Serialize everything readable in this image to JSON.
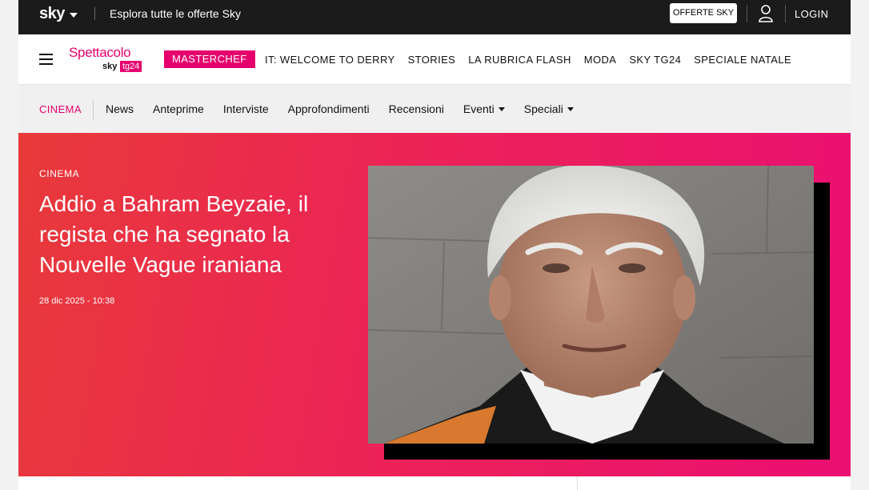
{
  "topbar": {
    "logo": "sky",
    "offers_link": "Esplora tutte le offerte Sky",
    "offers_button": "OFFERTE SKY",
    "login": "LOGIN",
    "icons": {
      "user": "user-icon",
      "chevron": "chevron-down-icon"
    }
  },
  "brand": {
    "name": "Spettacolo",
    "sub": "sky",
    "tag": "tg24"
  },
  "nav": {
    "highlight": "MASTERCHEF",
    "items": [
      "IT: WELCOME TO DERRY",
      "STORIES",
      "LA RUBRICA FLASH",
      "MODA",
      "SKY TG24",
      "SPECIALE NATALE"
    ]
  },
  "subnav": {
    "section": "CINEMA",
    "items": [
      "News",
      "Anteprime",
      "Interviste",
      "Approfondimenti",
      "Recensioni",
      "Eventi",
      "Speciali"
    ]
  },
  "hero": {
    "kicker": "CINEMA",
    "title": "Addio a Bahram Beyzaie, il regista che ha segnato la Nouvelle Vague iraniana",
    "date": "28 dic 2025 - 10:38"
  },
  "colors": {
    "accent": "#e5006d",
    "topbar": "#1b1b1b"
  }
}
